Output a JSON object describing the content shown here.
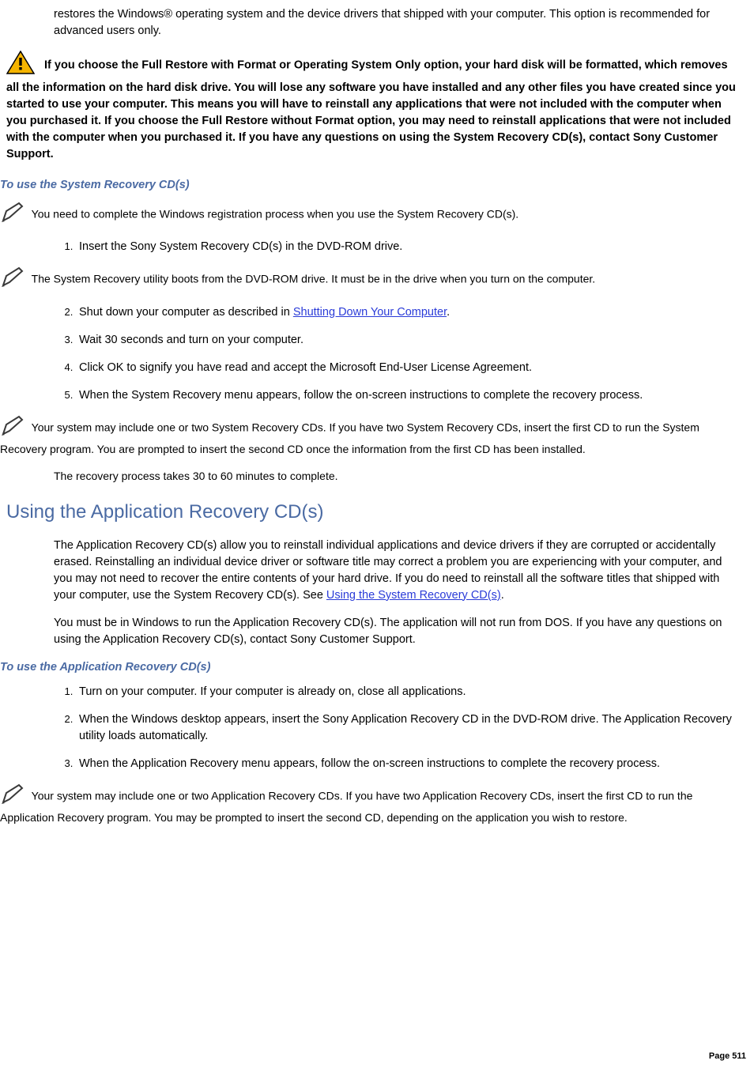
{
  "intro": {
    "para": "restores the Windows® operating system and the device drivers that shipped with your computer. This option is recommended for advanced users only."
  },
  "warning": {
    "text": "If you choose the Full Restore with Format or Operating System Only option, your hard disk will be formatted, which removes all the information on the hard disk drive. You will lose any software you have installed and any other files you have created since you started to use your computer. This means you will have to reinstall any applications that were not included with the computer when you purchased it. If you choose the Full Restore without Format option, you may need to reinstall applications that were not included with the computer when you purchased it. If you have any questions on using the System Recovery CD(s), contact Sony Customer Support."
  },
  "proc1": {
    "heading": "To use the System Recovery CD(s)",
    "note1": "You need to complete the Windows registration process when you use the System Recovery CD(s).",
    "step1": "Insert the Sony System Recovery CD(s) in the DVD-ROM drive.",
    "note2": "The System Recovery utility boots from the DVD-ROM drive. It must be in the drive when you turn on the computer.",
    "step2_pre": "Shut down your computer as described in ",
    "step2_link": "Shutting Down Your Computer",
    "step2_post": ".",
    "step3": "Wait 30 seconds and turn on your computer.",
    "step4": "Click OK to signify you have read and accept the Microsoft End-User License Agreement.",
    "step5": "When the System Recovery menu appears, follow the on-screen instructions to complete the recovery process.",
    "note3": "Your system may include one or two System Recovery CDs. If you have two System Recovery CDs, insert the first CD to run the System Recovery program. You are prompted to insert the second CD once the information from the first CD has been installed.",
    "note4": "The recovery process takes 30 to 60 minutes to complete."
  },
  "section2": {
    "heading": "Using the Application Recovery CD(s)",
    "para1_pre": "The Application Recovery CD(s) allow you to reinstall individual applications and device drivers if they are corrupted or accidentally erased. Reinstalling an individual device driver or software title may correct a problem you are experiencing with your computer, and you may not need to recover the entire contents of your hard drive. If you do need to reinstall all the software titles that shipped with your computer, use the System Recovery CD(s). See ",
    "para1_link": "Using the System Recovery CD(s)",
    "para1_post": ".",
    "para2": "You must be in Windows to run the Application Recovery CD(s). The application will not run from DOS. If you have any questions on using the Application Recovery CD(s), contact Sony Customer Support."
  },
  "proc2": {
    "heading": "To use the Application Recovery CD(s)",
    "step1": "Turn on your computer. If your computer is already on, close all applications.",
    "step2": "When the Windows desktop appears, insert the Sony Application Recovery CD in the DVD-ROM drive. The Application Recovery utility loads automatically.",
    "step3": "When the Application Recovery menu appears, follow the on-screen instructions to complete the recovery process.",
    "note": "Your system may include one or two Application Recovery CDs. If you have two Application Recovery CDs, insert the first CD to run the Application Recovery program. You may be prompted to insert the second CD, depending on the application you wish to restore."
  },
  "page": {
    "number": "Page 511"
  }
}
